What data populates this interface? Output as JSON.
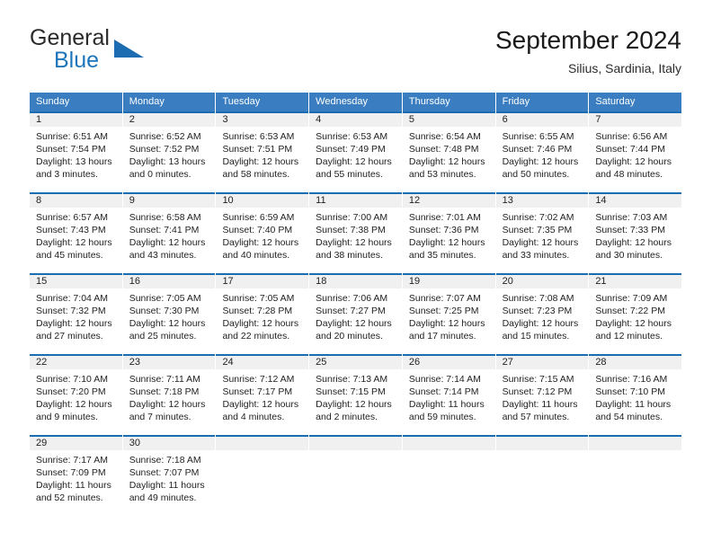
{
  "brand": {
    "name_part1": "General",
    "name_part2": "Blue",
    "flag_icon": "blue-triangle-flag-icon"
  },
  "header": {
    "title": "September 2024",
    "location": "Silius, Sardinia, Italy"
  },
  "colors": {
    "header_blue": "#3a7dc0",
    "cell_top_border_blue": "#1b6cb0",
    "daynum_band_gray": "#f0f0f0",
    "brand_blue": "#1b75bb",
    "text": "#222222"
  },
  "calendar": {
    "weekdays": [
      "Sunday",
      "Monday",
      "Tuesday",
      "Wednesday",
      "Thursday",
      "Friday",
      "Saturday"
    ],
    "weeks": [
      [
        {
          "day": "1",
          "sunrise": "Sunrise: 6:51 AM",
          "sunset": "Sunset: 7:54 PM",
          "daylight_line1": "Daylight: 13 hours",
          "daylight_line2": "and 3 minutes."
        },
        {
          "day": "2",
          "sunrise": "Sunrise: 6:52 AM",
          "sunset": "Sunset: 7:52 PM",
          "daylight_line1": "Daylight: 13 hours",
          "daylight_line2": "and 0 minutes."
        },
        {
          "day": "3",
          "sunrise": "Sunrise: 6:53 AM",
          "sunset": "Sunset: 7:51 PM",
          "daylight_line1": "Daylight: 12 hours",
          "daylight_line2": "and 58 minutes."
        },
        {
          "day": "4",
          "sunrise": "Sunrise: 6:53 AM",
          "sunset": "Sunset: 7:49 PM",
          "daylight_line1": "Daylight: 12 hours",
          "daylight_line2": "and 55 minutes."
        },
        {
          "day": "5",
          "sunrise": "Sunrise: 6:54 AM",
          "sunset": "Sunset: 7:48 PM",
          "daylight_line1": "Daylight: 12 hours",
          "daylight_line2": "and 53 minutes."
        },
        {
          "day": "6",
          "sunrise": "Sunrise: 6:55 AM",
          "sunset": "Sunset: 7:46 PM",
          "daylight_line1": "Daylight: 12 hours",
          "daylight_line2": "and 50 minutes."
        },
        {
          "day": "7",
          "sunrise": "Sunrise: 6:56 AM",
          "sunset": "Sunset: 7:44 PM",
          "daylight_line1": "Daylight: 12 hours",
          "daylight_line2": "and 48 minutes."
        }
      ],
      [
        {
          "day": "8",
          "sunrise": "Sunrise: 6:57 AM",
          "sunset": "Sunset: 7:43 PM",
          "daylight_line1": "Daylight: 12 hours",
          "daylight_line2": "and 45 minutes."
        },
        {
          "day": "9",
          "sunrise": "Sunrise: 6:58 AM",
          "sunset": "Sunset: 7:41 PM",
          "daylight_line1": "Daylight: 12 hours",
          "daylight_line2": "and 43 minutes."
        },
        {
          "day": "10",
          "sunrise": "Sunrise: 6:59 AM",
          "sunset": "Sunset: 7:40 PM",
          "daylight_line1": "Daylight: 12 hours",
          "daylight_line2": "and 40 minutes."
        },
        {
          "day": "11",
          "sunrise": "Sunrise: 7:00 AM",
          "sunset": "Sunset: 7:38 PM",
          "daylight_line1": "Daylight: 12 hours",
          "daylight_line2": "and 38 minutes."
        },
        {
          "day": "12",
          "sunrise": "Sunrise: 7:01 AM",
          "sunset": "Sunset: 7:36 PM",
          "daylight_line1": "Daylight: 12 hours",
          "daylight_line2": "and 35 minutes."
        },
        {
          "day": "13",
          "sunrise": "Sunrise: 7:02 AM",
          "sunset": "Sunset: 7:35 PM",
          "daylight_line1": "Daylight: 12 hours",
          "daylight_line2": "and 33 minutes."
        },
        {
          "day": "14",
          "sunrise": "Sunrise: 7:03 AM",
          "sunset": "Sunset: 7:33 PM",
          "daylight_line1": "Daylight: 12 hours",
          "daylight_line2": "and 30 minutes."
        }
      ],
      [
        {
          "day": "15",
          "sunrise": "Sunrise: 7:04 AM",
          "sunset": "Sunset: 7:32 PM",
          "daylight_line1": "Daylight: 12 hours",
          "daylight_line2": "and 27 minutes."
        },
        {
          "day": "16",
          "sunrise": "Sunrise: 7:05 AM",
          "sunset": "Sunset: 7:30 PM",
          "daylight_line1": "Daylight: 12 hours",
          "daylight_line2": "and 25 minutes."
        },
        {
          "day": "17",
          "sunrise": "Sunrise: 7:05 AM",
          "sunset": "Sunset: 7:28 PM",
          "daylight_line1": "Daylight: 12 hours",
          "daylight_line2": "and 22 minutes."
        },
        {
          "day": "18",
          "sunrise": "Sunrise: 7:06 AM",
          "sunset": "Sunset: 7:27 PM",
          "daylight_line1": "Daylight: 12 hours",
          "daylight_line2": "and 20 minutes."
        },
        {
          "day": "19",
          "sunrise": "Sunrise: 7:07 AM",
          "sunset": "Sunset: 7:25 PM",
          "daylight_line1": "Daylight: 12 hours",
          "daylight_line2": "and 17 minutes."
        },
        {
          "day": "20",
          "sunrise": "Sunrise: 7:08 AM",
          "sunset": "Sunset: 7:23 PM",
          "daylight_line1": "Daylight: 12 hours",
          "daylight_line2": "and 15 minutes."
        },
        {
          "day": "21",
          "sunrise": "Sunrise: 7:09 AM",
          "sunset": "Sunset: 7:22 PM",
          "daylight_line1": "Daylight: 12 hours",
          "daylight_line2": "and 12 minutes."
        }
      ],
      [
        {
          "day": "22",
          "sunrise": "Sunrise: 7:10 AM",
          "sunset": "Sunset: 7:20 PM",
          "daylight_line1": "Daylight: 12 hours",
          "daylight_line2": "and 9 minutes."
        },
        {
          "day": "23",
          "sunrise": "Sunrise: 7:11 AM",
          "sunset": "Sunset: 7:18 PM",
          "daylight_line1": "Daylight: 12 hours",
          "daylight_line2": "and 7 minutes."
        },
        {
          "day": "24",
          "sunrise": "Sunrise: 7:12 AM",
          "sunset": "Sunset: 7:17 PM",
          "daylight_line1": "Daylight: 12 hours",
          "daylight_line2": "and 4 minutes."
        },
        {
          "day": "25",
          "sunrise": "Sunrise: 7:13 AM",
          "sunset": "Sunset: 7:15 PM",
          "daylight_line1": "Daylight: 12 hours",
          "daylight_line2": "and 2 minutes."
        },
        {
          "day": "26",
          "sunrise": "Sunrise: 7:14 AM",
          "sunset": "Sunset: 7:14 PM",
          "daylight_line1": "Daylight: 11 hours",
          "daylight_line2": "and 59 minutes."
        },
        {
          "day": "27",
          "sunrise": "Sunrise: 7:15 AM",
          "sunset": "Sunset: 7:12 PM",
          "daylight_line1": "Daylight: 11 hours",
          "daylight_line2": "and 57 minutes."
        },
        {
          "day": "28",
          "sunrise": "Sunrise: 7:16 AM",
          "sunset": "Sunset: 7:10 PM",
          "daylight_line1": "Daylight: 11 hours",
          "daylight_line2": "and 54 minutes."
        }
      ],
      [
        {
          "day": "29",
          "sunrise": "Sunrise: 7:17 AM",
          "sunset": "Sunset: 7:09 PM",
          "daylight_line1": "Daylight: 11 hours",
          "daylight_line2": "and 52 minutes."
        },
        {
          "day": "30",
          "sunrise": "Sunrise: 7:18 AM",
          "sunset": "Sunset: 7:07 PM",
          "daylight_line1": "Daylight: 11 hours",
          "daylight_line2": "and 49 minutes."
        },
        {
          "day": "",
          "sunrise": "",
          "sunset": "",
          "daylight_line1": "",
          "daylight_line2": ""
        },
        {
          "day": "",
          "sunrise": "",
          "sunset": "",
          "daylight_line1": "",
          "daylight_line2": ""
        },
        {
          "day": "",
          "sunrise": "",
          "sunset": "",
          "daylight_line1": "",
          "daylight_line2": ""
        },
        {
          "day": "",
          "sunrise": "",
          "sunset": "",
          "daylight_line1": "",
          "daylight_line2": ""
        },
        {
          "day": "",
          "sunrise": "",
          "sunset": "",
          "daylight_line1": "",
          "daylight_line2": ""
        }
      ]
    ]
  }
}
